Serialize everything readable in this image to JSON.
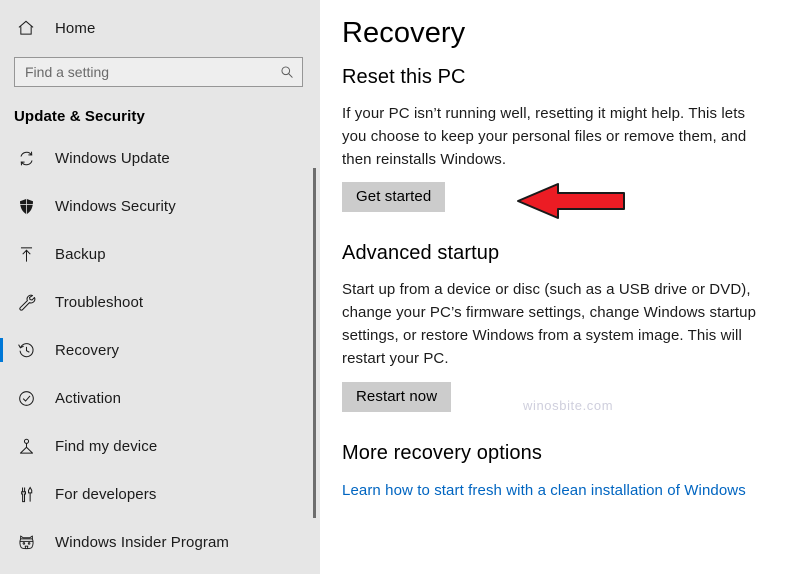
{
  "sidebar": {
    "home": {
      "label": "Home",
      "icon": "home-icon"
    },
    "search": {
      "placeholder": "Find a setting",
      "value": "",
      "icon": "search-icon"
    },
    "section_title": "Update & Security",
    "accent_color": "#0078d7",
    "background_color": "#e6e6e6",
    "items": [
      {
        "label": "Windows Update",
        "icon": "sync-icon",
        "selected": false
      },
      {
        "label": "Windows Security",
        "icon": "shield-icon",
        "selected": false
      },
      {
        "label": "Backup",
        "icon": "upload-arrow-icon",
        "selected": false
      },
      {
        "label": "Troubleshoot",
        "icon": "wrench-icon",
        "selected": false
      },
      {
        "label": "Recovery",
        "icon": "history-clock-icon",
        "selected": true
      },
      {
        "label": "Activation",
        "icon": "check-circle-icon",
        "selected": false
      },
      {
        "label": "Find my device",
        "icon": "location-pin-icon",
        "selected": false
      },
      {
        "label": "For developers",
        "icon": "developer-tools-icon",
        "selected": false
      },
      {
        "label": "Windows Insider Program",
        "icon": "ninjacat-icon",
        "selected": false
      }
    ]
  },
  "main": {
    "page_title": "Recovery",
    "sections": [
      {
        "heading": "Reset this PC",
        "description": "If your PC isn’t running well, resetting it might help. This lets you choose to keep your personal files or remove them, and then reinstalls Windows.",
        "button": "Get started"
      },
      {
        "heading": "Advanced startup",
        "description": "Start up from a device or disc (such as a USB drive or DVD), change your PC’s firmware settings, change Windows startup settings, or restore Windows from a system image. This will restart your PC.",
        "button": "Restart now"
      },
      {
        "heading": "More recovery options",
        "link": "Learn how to start fresh with a clean installation of Windows"
      }
    ]
  },
  "annotations": {
    "arrow": {
      "name": "red-arrow-pointing-to-get-started",
      "direction": "left",
      "fill_color": "#ec1c24",
      "stroke_color": "#1a1a1a"
    },
    "watermark": "winosbite.com"
  }
}
